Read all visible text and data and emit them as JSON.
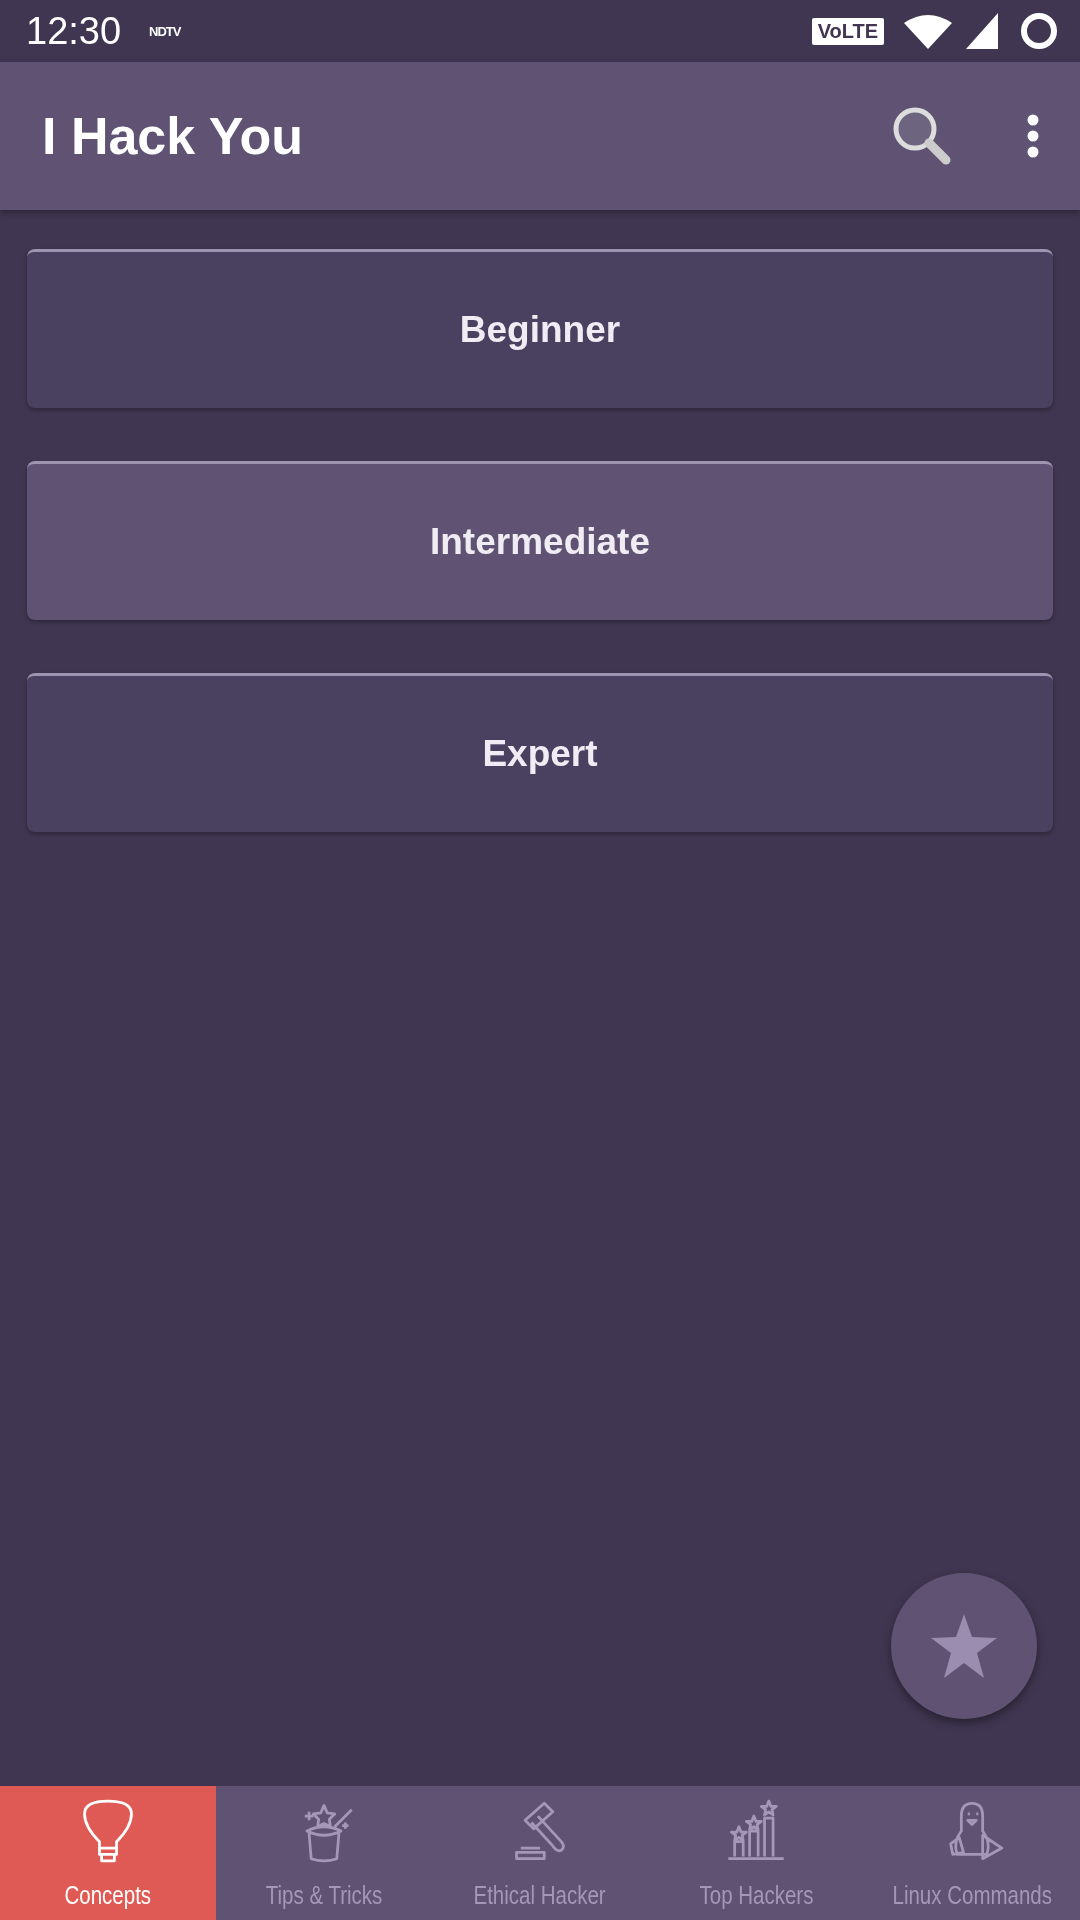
{
  "status_bar": {
    "time": "12:30",
    "notification": "NDTV",
    "network_badge": "VoLTE"
  },
  "app_bar": {
    "title": "I Hack You"
  },
  "levels": [
    {
      "label": "Beginner",
      "selected": false
    },
    {
      "label": "Intermediate",
      "selected": true
    },
    {
      "label": "Expert",
      "selected": false
    }
  ],
  "bottom_nav": [
    {
      "label": "Concepts",
      "kind": "bulb",
      "selected": true
    },
    {
      "label": "Tips & Tricks",
      "kind": "hat",
      "selected": false
    },
    {
      "label": "Ethical Hacker",
      "kind": "gavel",
      "selected": false
    },
    {
      "label": "Top Hackers",
      "kind": "chart",
      "selected": false
    },
    {
      "label": "Linux Commands",
      "kind": "penguin",
      "selected": false
    }
  ]
}
